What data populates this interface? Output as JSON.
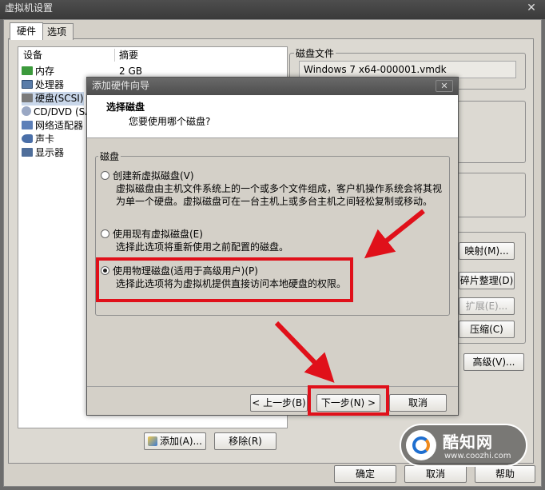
{
  "outer": {
    "title": "虚拟机设置",
    "close_glyph": "✕",
    "tabs": [
      {
        "label": "硬件"
      },
      {
        "label": "选项"
      }
    ],
    "columns": {
      "device": "设备",
      "summary": "摘要"
    },
    "devices": [
      {
        "name": "内存",
        "summary": "2 GB",
        "icon": "memory-icon",
        "color": "#3c9a3c"
      },
      {
        "name": "处理器",
        "summary": "",
        "icon": "cpu-icon",
        "color": "#5a7ca8"
      },
      {
        "name": "硬盘(SCSI)",
        "summary": "",
        "icon": "harddisk-icon",
        "color": "#7a7a7a"
      },
      {
        "name": "CD/DVD (SA",
        "summary": "",
        "icon": "cdrom-icon",
        "color": "#9aa8c4"
      },
      {
        "name": "网络适配器",
        "summary": "",
        "icon": "network-icon",
        "color": "#5c7fb8"
      },
      {
        "name": "声卡",
        "summary": "",
        "icon": "sound-icon",
        "color": "#4a6fa8"
      },
      {
        "name": "显示器",
        "summary": "",
        "icon": "display-icon",
        "color": "#4f6e9a"
      }
    ],
    "disk_file": {
      "label": "磁盘文件",
      "value": "Windows 7 x64-000001.vmdk"
    },
    "buttons": {
      "map": "映射(M)...",
      "defrag": "碎片整理(D)",
      "expand": "扩展(E)...",
      "compact": "压缩(C)",
      "advanced": "高级(V)...",
      "add": "添加(A)...",
      "remove": "移除(R)",
      "ok": "确定",
      "cancel": "取消",
      "help": "帮助"
    }
  },
  "wizard": {
    "title": "添加硬件向导",
    "close_glyph": "✕",
    "heading": "选择磁盘",
    "subheading": "您要使用哪个磁盘?",
    "group_label": "磁盘",
    "options": [
      {
        "label": "创建新虚拟磁盘(V)",
        "desc": "虚拟磁盘由主机文件系统上的一个或多个文件组成，客户机操作系统会将其视为单一个硬盘。虚拟磁盘可在一台主机上或多台主机之间轻松复制或移动。",
        "selected": false
      },
      {
        "label": "使用现有虚拟磁盘(E)",
        "desc": "选择此选项将重新使用之前配置的磁盘。",
        "selected": false
      },
      {
        "label": "使用物理磁盘(适用于高级用户)(P)",
        "desc": "选择此选项将为虚拟机提供直接访问本地硬盘的权限。",
        "selected": true
      }
    ],
    "buttons": {
      "back": "< 上一步(B)",
      "next": "下一步(N) >",
      "cancel": "取消"
    }
  },
  "watermark": {
    "brand": "酷知网",
    "url": "www.coozhi.com"
  },
  "colors": {
    "highlight": "#e0101a",
    "accent_blue": "#1f6fd0"
  }
}
